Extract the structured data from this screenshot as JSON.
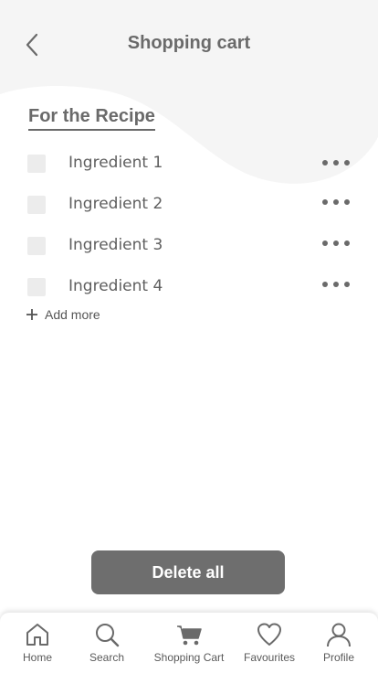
{
  "header": {
    "title": "Shopping cart",
    "back_icon": "chevron-left-icon"
  },
  "section": {
    "title": "For the Recipe"
  },
  "ingredients": [
    {
      "label": "Ingredient 1",
      "checked": false
    },
    {
      "label": "Ingredient 2",
      "checked": false
    },
    {
      "label": "Ingredient 3",
      "checked": false
    },
    {
      "label": "Ingredient 4",
      "checked": false
    }
  ],
  "add_more": {
    "label": "Add more",
    "icon": "plus-icon"
  },
  "delete_all": {
    "label": "Delete all"
  },
  "tabbar": {
    "items": [
      {
        "label": "Home",
        "icon": "home-icon"
      },
      {
        "label": "Search",
        "icon": "search-icon"
      },
      {
        "label": "Shopping Cart",
        "icon": "cart-icon"
      },
      {
        "label": "Favourites",
        "icon": "heart-icon"
      },
      {
        "label": "Profile",
        "icon": "user-icon"
      }
    ]
  },
  "colors": {
    "primary": "#6e6e6e",
    "background_shape": "#f5f5f5",
    "checkbox": "#ececec"
  }
}
